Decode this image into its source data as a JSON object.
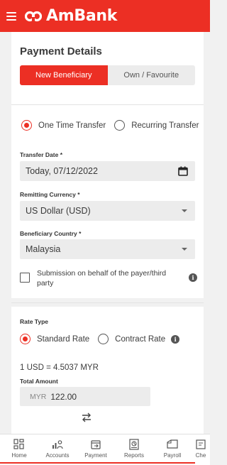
{
  "header": {
    "brand": "AmBank",
    "brand_color": "#ec2f24",
    "menu_icon": "hamburger-icon"
  },
  "payment_details": {
    "title": "Payment Details",
    "tabs": [
      {
        "label": "New Beneficiary",
        "active": true
      },
      {
        "label": "Own / Favourite",
        "active": false
      }
    ]
  },
  "transfer": {
    "options": [
      {
        "label": "One Time Transfer",
        "selected": true
      },
      {
        "label": "Recurring Transfer",
        "selected": false
      }
    ],
    "date_label": "Transfer Date *",
    "date_value": "Today, 07/12/2022",
    "currency_label": "Remitting Currency *",
    "currency_value": "US Dollar (USD)",
    "country_label": "Beneficiary Country *",
    "country_value": "Malaysia",
    "on_behalf_label": "Submission on behalf of the payer/third party",
    "on_behalf_checked": false
  },
  "rate": {
    "title": "Rate Type",
    "options": [
      {
        "label": "Standard Rate",
        "selected": true
      },
      {
        "label": "Contract Rate",
        "selected": false
      }
    ],
    "exchange_text": "1 USD = 4.5037 MYR",
    "total_label": "Total Amount",
    "total_currency": "MYR",
    "total_value": "122.00"
  },
  "bottom_nav": [
    {
      "label": "Home",
      "icon": "home-icon"
    },
    {
      "label": "Accounts",
      "icon": "accounts-icon"
    },
    {
      "label": "Payment",
      "icon": "payment-icon"
    },
    {
      "label": "Reports",
      "icon": "reports-icon"
    },
    {
      "label": "Payroll",
      "icon": "payroll-icon"
    },
    {
      "label": "Che",
      "icon": "cheque-icon"
    }
  ]
}
